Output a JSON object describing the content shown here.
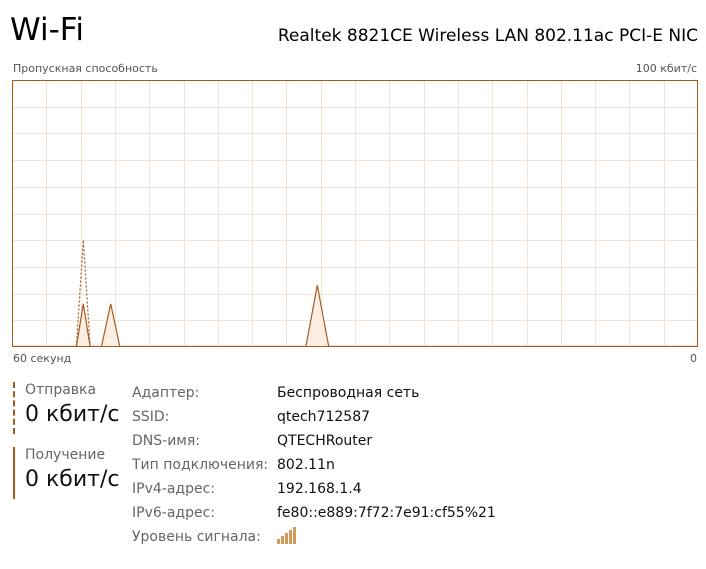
{
  "header": {
    "title": "Wi-Fi",
    "adapter": "Realtek 8821CE Wireless LAN 802.11ac PCI-E NIC"
  },
  "chart": {
    "title": "Пропускная способность",
    "max_label": "100 кбит/с",
    "time_label": "60 секунд",
    "zero_label": "0"
  },
  "chart_data": {
    "type": "area",
    "x_range": [
      60,
      0
    ],
    "ylim": [
      0,
      100
    ],
    "unit": "кбит/с",
    "grid": true,
    "series": [
      {
        "name": "Отправка",
        "style": "dashed",
        "color": "#a75a1e",
        "x": [
          60,
          55,
          54.4,
          53.8,
          53.2,
          0
        ],
        "values": [
          0,
          0,
          0,
          40,
          0,
          0
        ]
      },
      {
        "name": "Получение",
        "style": "solid",
        "color": "#a75a1e",
        "x": [
          60,
          55,
          54.4,
          53.8,
          53.2,
          52.2,
          51.4,
          50.6,
          34.3,
          33.3,
          32.3,
          0
        ],
        "values": [
          0,
          0,
          0,
          16,
          0,
          0,
          16,
          0,
          0,
          23,
          0,
          0
        ]
      }
    ]
  },
  "metrics": {
    "send_label": "Отправка",
    "send_value": "0 кбит/с",
    "recv_label": "Получение",
    "recv_value": "0 кбит/с"
  },
  "properties": [
    {
      "key": "Адаптер:",
      "value": "Беспроводная сеть"
    },
    {
      "key": "SSID:",
      "value": "qtech712587"
    },
    {
      "key": "DNS-имя:",
      "value": "QTECHRouter"
    },
    {
      "key": "Тип подключения:",
      "value": "802.11n"
    },
    {
      "key": "IPv4-адрес:",
      "value": "192.168.1.4"
    },
    {
      "key": "IPv6-адрес:",
      "value": "fe80::e889:7f72:7e91:cf55%21"
    },
    {
      "key": "Уровень сигнала:",
      "value": ""
    }
  ],
  "signal_icon": "signal-strength-icon",
  "signal_bars": 5
}
